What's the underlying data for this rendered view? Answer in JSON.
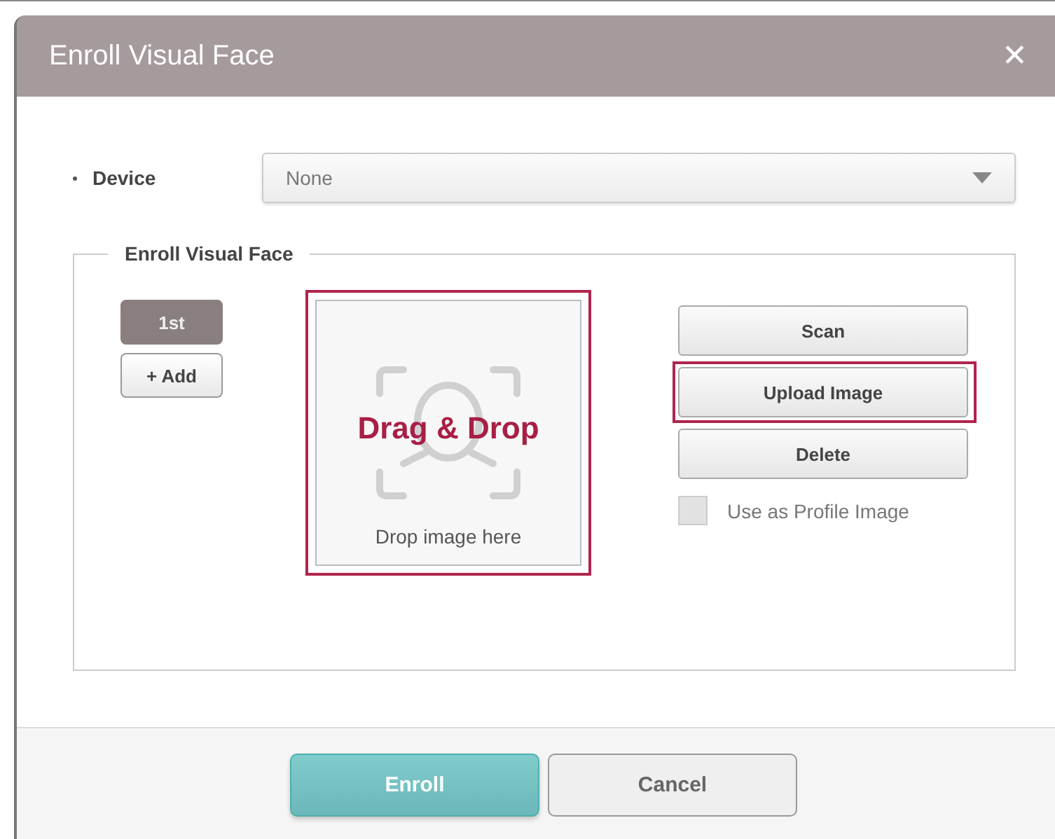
{
  "window": {
    "title": "Enroll Visual Face",
    "close": "✕"
  },
  "device": {
    "label": "Device",
    "value": "None"
  },
  "section": {
    "legend": "Enroll Visual Face",
    "slots": [
      {
        "label": "1st",
        "selected": true
      },
      {
        "label": "+ Add",
        "selected": false
      }
    ],
    "drop_zone": {
      "title": "Drag & Drop",
      "hint": "Drop image here",
      "highlighted": true
    },
    "actions": [
      {
        "label": "Scan",
        "highlighted": false
      },
      {
        "label": "Upload Image",
        "highlighted": true
      },
      {
        "label": "Delete",
        "highlighted": false
      }
    ],
    "profile_checkbox": {
      "label": "Use as Profile Image",
      "checked": false,
      "disabled": true
    }
  },
  "buttons": [
    {
      "label": "Enroll",
      "kind": "primary"
    },
    {
      "label": "Cancel",
      "kind": "secondary"
    }
  ]
}
